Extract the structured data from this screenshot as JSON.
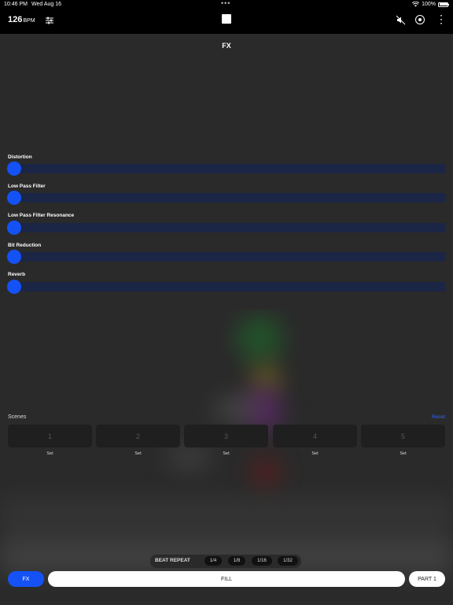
{
  "status_bar": {
    "time": "10:46 PM",
    "date": "Wed Aug 16",
    "dots": "•••",
    "battery": "100%"
  },
  "toolbar": {
    "bpm_value": "126",
    "bpm_unit": "BPM",
    "icons": [
      "mixer-icon",
      "stop-icon",
      "mute-icon",
      "record-icon",
      "more-icon"
    ]
  },
  "fx_panel": {
    "title": "FX",
    "sliders": [
      {
        "label": "Distortion",
        "value": 0
      },
      {
        "label": "Low Pass Filter",
        "value": 0
      },
      {
        "label": "Low Pass Filter Resonance",
        "value": 0
      },
      {
        "label": "Bit Reduction",
        "value": 0
      },
      {
        "label": "Reverb",
        "value": 0
      }
    ]
  },
  "scenes": {
    "label": "Scenes",
    "reset_label": "Reset",
    "pads": [
      {
        "number": "1",
        "set_label": "Set"
      },
      {
        "number": "2",
        "set_label": "Set"
      },
      {
        "number": "3",
        "set_label": "Set"
      },
      {
        "number": "4",
        "set_label": "Set"
      },
      {
        "number": "5",
        "set_label": "Set"
      }
    ]
  },
  "beat_repeat": {
    "label": "BEAT REPEAT",
    "options": [
      "1/4",
      "1/8",
      "1/16",
      "1/32"
    ]
  },
  "bottom_bar": {
    "fx_label": "FX",
    "fill_label": "FILL",
    "part_label": "PART 1"
  },
  "colors": {
    "accent": "#1552f5",
    "slider_track": "#1b2546",
    "toolbar_bg": "#000000",
    "panel_bg": "#2a2a2a"
  }
}
